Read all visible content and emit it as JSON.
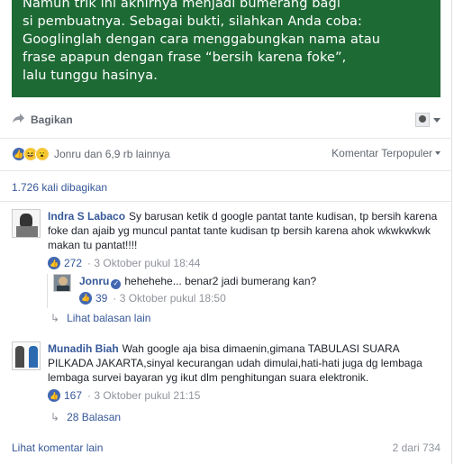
{
  "post": {
    "banner_lines": [
      "Namun trik ini akhirnya menjadi bumerang bagi",
      "si pembuatnya. Sebagai bukti, silahkan Anda coba:",
      "Googlinglah dengan cara menggabungkan nama atau",
      "frase apapun dengan frase “bersih karena foke”,",
      "lalu tunggu hasinya."
    ],
    "share_label": "Bagikan",
    "reactions_text": "Jonru dan 6,9 rb lainnya",
    "sort_label": "Komentar Terpopuler",
    "shares_count": "1.726 kali dibagikan"
  },
  "comments": [
    {
      "author": "Indra S Labaco",
      "text": "Sy barusan ketik d google pantat tante kudisan, tp bersih karena foke dan ajaib yg muncul pantat tante kudisan tp bersih karena ahok wkwkwkwk makan tu pantat!!!!",
      "likes": "272",
      "time": "3 Oktober pukul 18:44",
      "reply": {
        "author": "Jonru",
        "text": "hehehehe... benar2 jadi bumerang kan?",
        "likes": "39",
        "time": "3 Oktober pukul 18:50"
      },
      "more_replies": "Lihat balasan lain"
    },
    {
      "author": "Munadih Biah",
      "text": "Wah google aja bisa dimaenin,gimana TABULASI SUARA PILKADA JAKARTA,sinyal kecurangan udah dimulai,hati-hati juga dg lembaga lembaga survei bayaran yg ikut dlm penghitungan suara elektronik.",
      "likes": "167",
      "time": "3 Oktober pukul 21:15",
      "replies_link": "28 Balasan"
    }
  ],
  "footer": {
    "more_comments": "Lihat komentar lain",
    "pagination": "2 dari 734"
  },
  "colors": {
    "banner": "#1e6a35",
    "link": "#365899",
    "like": "#4267b2"
  }
}
